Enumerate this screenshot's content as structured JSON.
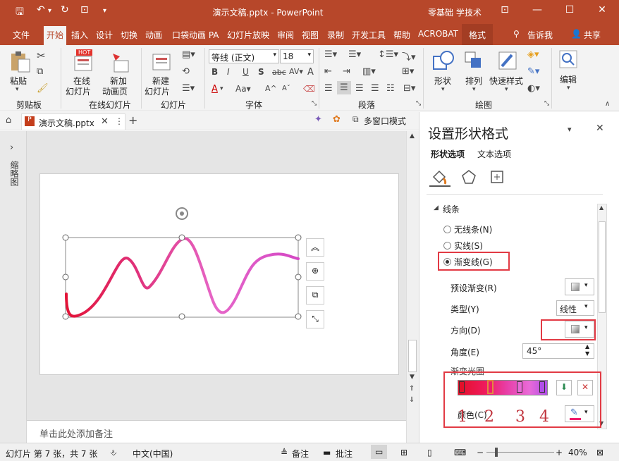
{
  "titlebar": {
    "doc_title": "演示文稿.pptx  -  PowerPoint",
    "user": "零基础 学技术"
  },
  "tabs": [
    "文件",
    "开始",
    "插入",
    "设计",
    "切换",
    "动画",
    "口袋动画 PA",
    "幻灯片放映",
    "审阅",
    "视图",
    "录制",
    "开发工具",
    "帮助",
    "ACROBAT",
    "格式"
  ],
  "tell_me": "告诉我",
  "share": "共享",
  "ribbon": {
    "paste": "粘贴",
    "clipboard_group": "剪贴板",
    "hot_badge": "HOT",
    "online_slides": [
      "在线",
      "幻灯片"
    ],
    "new_anim": [
      "新加",
      "动画页"
    ],
    "online_group": "在线幻灯片",
    "new_slide": [
      "新建",
      "幻灯片"
    ],
    "slides_group": "幻灯片",
    "font_name": "等线 (正文)",
    "font_size": "18",
    "font_group": "字体",
    "para_group": "段落",
    "shape": "形状",
    "arrange": "排列",
    "quick_style": "快速样式",
    "drawing_group": "绘图",
    "edit": "编辑"
  },
  "file_tab": "演示文稿.pptx",
  "multi_window": "多窗口模式",
  "thumbnails_label": "缩略图",
  "notes_placeholder": "单击此处添加备注",
  "pane": {
    "title": "设置形状格式",
    "tab_shape": "形状选项",
    "tab_text": "文本选项",
    "section": "线条",
    "radios": [
      {
        "label": "无线条(N)",
        "checked": false
      },
      {
        "label": "实线(S)",
        "checked": false
      },
      {
        "label": "渐变线(G)",
        "checked": true
      }
    ],
    "preset_label": "预设渐变(R)",
    "type_label": "类型(Y)",
    "type_value": "线性",
    "direction_label": "方向(D)",
    "angle_label": "角度(E)",
    "angle_value": "45°",
    "stops_label": "渐变光圈",
    "color_label": "颜色(C)",
    "stop_numbers": [
      "1",
      "2",
      "3",
      "4"
    ]
  },
  "status": {
    "slide_info": "幻灯片 第 7 张，共 7 张",
    "language": "中文(中国)",
    "notes": "备注",
    "comments": "批注",
    "zoom": "40%"
  },
  "colors": {
    "accent": "#b7472a",
    "highlight": "#e23a44"
  }
}
